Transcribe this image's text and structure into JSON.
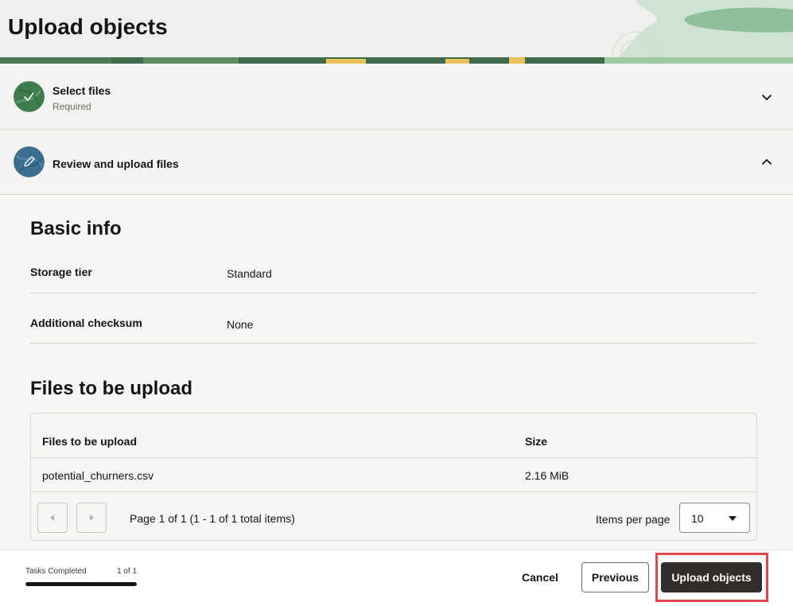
{
  "header": {
    "title": "Upload objects"
  },
  "steps": [
    {
      "title": "Select files",
      "subtitle": "Required",
      "status": "completed",
      "chevron": "chevron-down",
      "icon": "checkmark-icon"
    },
    {
      "title": "Review and upload files",
      "subtitle": "",
      "status": "in-progress",
      "chevron": "chevron-up",
      "icon": "pencil-icon"
    }
  ],
  "basic_info": {
    "title": "Basic info",
    "rows": [
      {
        "label": "Storage tier",
        "value": "Standard"
      },
      {
        "label": "Additional checksum",
        "value": "None"
      }
    ]
  },
  "files": {
    "title": "Files to be upload",
    "columns": [
      "Files to be upload",
      "Size"
    ],
    "rows": [
      [
        "potential_churners.csv",
        "2.16 MiB"
      ]
    ],
    "pagination": {
      "status": "Page 1 of 1 (1 - 1 of 1 total items)",
      "items_per_page_label": "Items per page",
      "items_per_page": "10"
    }
  },
  "footer": {
    "tasks_label": "Tasks Completed",
    "tasks_count": "1 of 1",
    "tasks_progress": 1.0,
    "cancel": "Cancel",
    "previous": "Previous",
    "upload": "Upload objects"
  },
  "colors": {
    "primary_button": "#312d2a",
    "highlight": "#e0474c",
    "step_done": "#3f7d4e",
    "step_active": "#3c6e8f"
  }
}
